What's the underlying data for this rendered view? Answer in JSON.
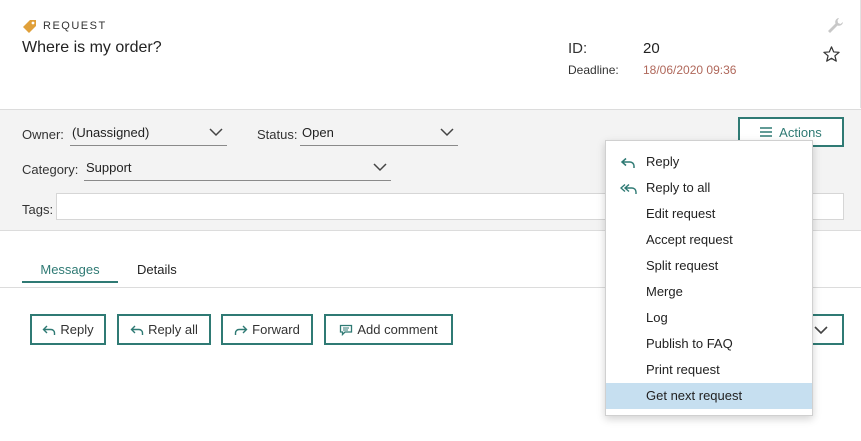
{
  "header": {
    "label": "REQUEST",
    "title": "Where is my order?",
    "id_label": "ID:",
    "id_value": "20",
    "deadline_label": "Deadline:",
    "deadline_value": "18/06/2020 09:36"
  },
  "form": {
    "owner_label": "Owner:",
    "owner_value": "(Unassigned)",
    "status_label": "Status:",
    "status_value": "Open",
    "category_label": "Category:",
    "category_value": "Support",
    "tags_label": "Tags:",
    "tags_value": "",
    "actions_label": "Actions"
  },
  "tabs": {
    "messages": "Messages",
    "details": "Details"
  },
  "toolbar": {
    "reply": "Reply",
    "reply_all": "Reply all",
    "forward": "Forward",
    "add_comment": "Add comment"
  },
  "menu": {
    "items": [
      {
        "label": "Reply",
        "icon": "reply-icon"
      },
      {
        "label": "Reply to all",
        "icon": "reply-all-icon"
      },
      {
        "label": "Edit request",
        "icon": ""
      },
      {
        "label": "Accept request",
        "icon": ""
      },
      {
        "label": "Split request",
        "icon": ""
      },
      {
        "label": "Merge",
        "icon": ""
      },
      {
        "label": "Log",
        "icon": ""
      },
      {
        "label": "Publish to FAQ",
        "icon": ""
      },
      {
        "label": "Print request",
        "icon": ""
      },
      {
        "label": "Get next request",
        "icon": "",
        "highlighted": true
      }
    ]
  },
  "colors": {
    "accent": "#2f7a74",
    "deadline": "#b0685b",
    "highlight": "#c6dff0",
    "tag_icon": "#e0a03a"
  }
}
